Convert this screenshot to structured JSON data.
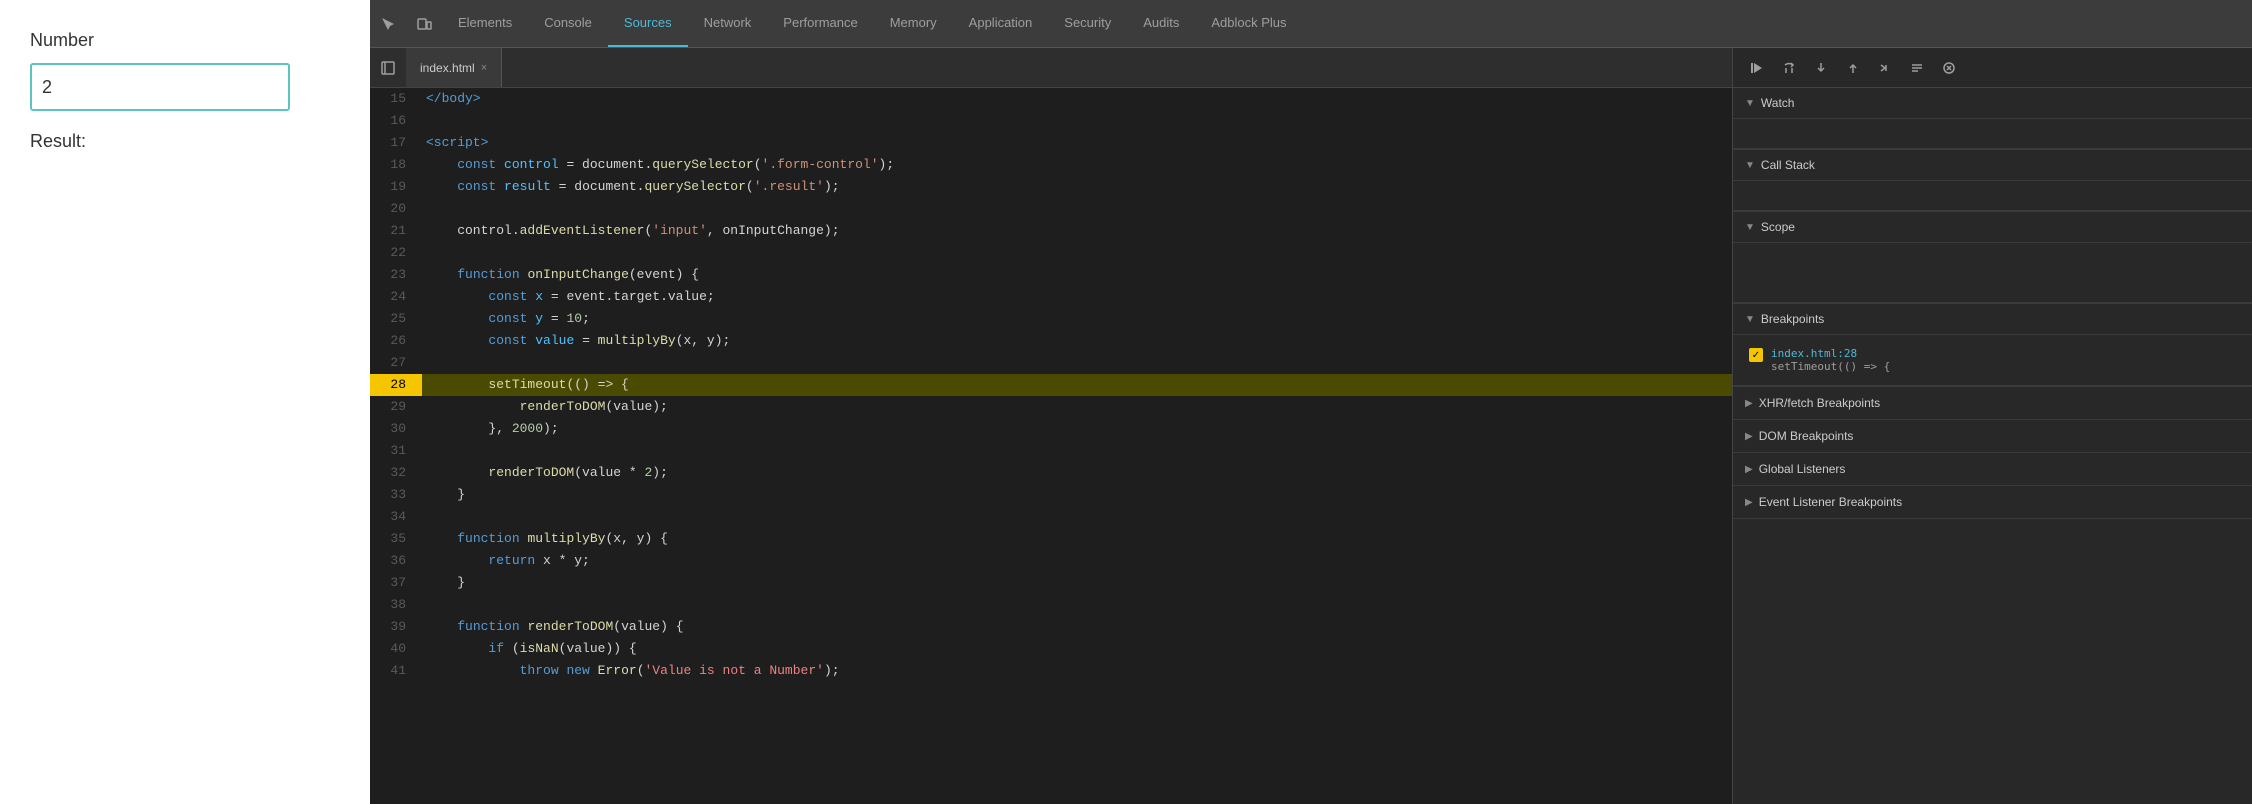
{
  "webpage": {
    "number_label": "Number",
    "result_label": "Result:",
    "input_value": "2",
    "input_placeholder": ""
  },
  "devtools": {
    "tabs": [
      {
        "label": "Elements",
        "active": false
      },
      {
        "label": "Console",
        "active": false
      },
      {
        "label": "Sources",
        "active": true
      },
      {
        "label": "Network",
        "active": false
      },
      {
        "label": "Performance",
        "active": false
      },
      {
        "label": "Memory",
        "active": false
      },
      {
        "label": "Application",
        "active": false
      },
      {
        "label": "Security",
        "active": false
      },
      {
        "label": "Audits",
        "active": false
      },
      {
        "label": "Adblock Plus",
        "active": false
      }
    ],
    "file_tab": {
      "name": "index.html",
      "close": "×"
    }
  },
  "right_panel": {
    "sections": {
      "watch": "Watch",
      "call_stack": "Call Stack",
      "scope": "Scope",
      "breakpoints": "Breakpoints",
      "xhr_fetch": "XHR/fetch Breakpoints",
      "dom_breakpoints": "DOM Breakpoints",
      "global_listeners": "Global Listeners",
      "event_listener_bp": "Event Listener Breakpoints"
    },
    "breakpoint": {
      "filename": "index.html:28",
      "code": "setTimeout(() => {"
    }
  },
  "code_lines": [
    {
      "num": 15,
      "content": "</body>",
      "highlight": false
    },
    {
      "num": 16,
      "content": "",
      "highlight": false
    },
    {
      "num": 17,
      "content": "<script>",
      "highlight": false
    },
    {
      "num": 18,
      "content": "    const control = document.querySelector('.form-control');",
      "highlight": false
    },
    {
      "num": 19,
      "content": "    const result = document.querySelector('.result');",
      "highlight": false
    },
    {
      "num": 20,
      "content": "",
      "highlight": false
    },
    {
      "num": 21,
      "content": "    control.addEventListener('input', onInputChange);",
      "highlight": false
    },
    {
      "num": 22,
      "content": "",
      "highlight": false
    },
    {
      "num": 23,
      "content": "    function onInputChange(event) {",
      "highlight": false
    },
    {
      "num": 24,
      "content": "        const x = event.target.value;",
      "highlight": false
    },
    {
      "num": 25,
      "content": "        const y = 10;",
      "highlight": false
    },
    {
      "num": 26,
      "content": "        const value = multiplyBy(x, y);",
      "highlight": false
    },
    {
      "num": 27,
      "content": "",
      "highlight": false
    },
    {
      "num": 28,
      "content": "        setTimeout(() => {",
      "highlight": true
    },
    {
      "num": 29,
      "content": "            renderToDOM(value);",
      "highlight": false
    },
    {
      "num": 30,
      "content": "        }, 2000);",
      "highlight": false
    },
    {
      "num": 31,
      "content": "",
      "highlight": false
    },
    {
      "num": 32,
      "content": "        renderToDOM(value * 2);",
      "highlight": false
    },
    {
      "num": 33,
      "content": "    }",
      "highlight": false
    },
    {
      "num": 34,
      "content": "",
      "highlight": false
    },
    {
      "num": 35,
      "content": "    function multiplyBy(x, y) {",
      "highlight": false
    },
    {
      "num": 36,
      "content": "        return x * y;",
      "highlight": false
    },
    {
      "num": 37,
      "content": "    }",
      "highlight": false
    },
    {
      "num": 38,
      "content": "",
      "highlight": false
    },
    {
      "num": 39,
      "content": "    function renderToDOM(value) {",
      "highlight": false
    },
    {
      "num": 40,
      "content": "        if (isNaN(value)) {",
      "highlight": false
    },
    {
      "num": 41,
      "content": "            throw new Error('Value is not a Number');",
      "highlight": false
    }
  ]
}
